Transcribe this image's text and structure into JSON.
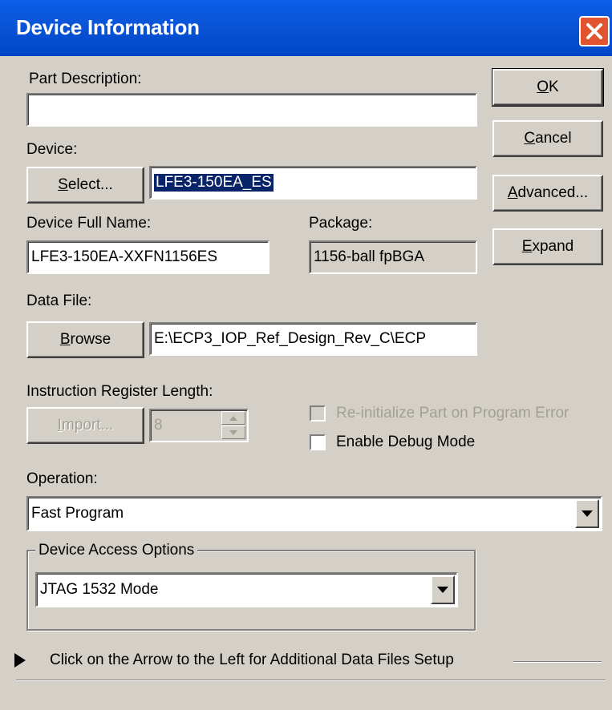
{
  "window": {
    "title": "Device Information",
    "accent": "#0a5ee8",
    "close_color": "#e2542f"
  },
  "buttons": {
    "ok": {
      "pre": "",
      "mnemonic": "O",
      "post": "K"
    },
    "cancel": {
      "pre": "",
      "mnemonic": "C",
      "post": "ancel"
    },
    "advanced": {
      "pre": "",
      "mnemonic": "A",
      "post": "dvanced..."
    },
    "expand": {
      "pre": "",
      "mnemonic": "E",
      "post": "xpand"
    },
    "select": {
      "pre": "",
      "mnemonic": "S",
      "post": "elect..."
    },
    "browse": {
      "pre": "",
      "mnemonic": "B",
      "post": "rowse"
    },
    "import": {
      "pre": "",
      "mnemonic": "I",
      "post": "mport..."
    }
  },
  "labels": {
    "part_description": "Part Description:",
    "device": "Device:",
    "device_full_name": "Device Full Name:",
    "package": "Package:",
    "data_file": "Data File:",
    "instruction_register_length": "Instruction Register Length:",
    "operation": "Operation:",
    "device_access_options": "Device Access Options"
  },
  "fields": {
    "part_description": "",
    "device": "LFE3-150EA_ES",
    "device_full_name": "LFE3-150EA-XXFN1156ES",
    "package": "1156-ball fpBGA",
    "data_file": "E:\\ECP3_IOP_Ref_Design_Rev_C\\ECP",
    "ir_length": "8"
  },
  "checkboxes": {
    "reinitialize": {
      "label": "Re-initialize Part on Program Error",
      "checked": false,
      "enabled": false
    },
    "debug_mode": {
      "label": "Enable Debug Mode",
      "checked": false,
      "enabled": true
    }
  },
  "dropdowns": {
    "operation": "Fast Program",
    "access_mode": "JTAG 1532 Mode"
  },
  "footer": {
    "additional_files_hint": "Click on the Arrow to the Left for Additional Data Files Setup"
  },
  "icons": {
    "close": "close-icon",
    "dropdown": "chevron-down-icon",
    "expand_arrow": "triangle-right-icon",
    "spin_up": "spin-up-icon",
    "spin_down": "spin-down-icon"
  }
}
